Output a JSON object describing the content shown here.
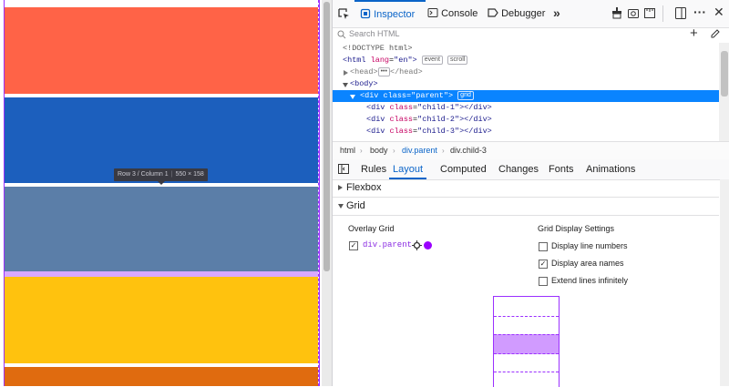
{
  "preview": {
    "tooltip": {
      "area": "Row 3 / Column 1",
      "size": "550 × 158"
    },
    "colors": [
      "#ff6347",
      "#1c5fbd",
      "#5b7ea8",
      "#ffc20e",
      "#e06b0f"
    ]
  },
  "toolbar": {
    "tabs": [
      {
        "label": "Inspector"
      },
      {
        "label": "Console"
      },
      {
        "label": "Debugger"
      }
    ],
    "more_label": "»"
  },
  "search": {
    "placeholder": "Search HTML"
  },
  "markup": {
    "doctype": "<!DOCTYPE html>",
    "html_open": "<html",
    "lang_attr": "lang",
    "lang_val": "\"en\"",
    "html_close_bracket": ">",
    "badge_event": "event",
    "badge_scroll": "scroll",
    "head_open": "<head>",
    "head_close": "</head>",
    "ellipsis": "•••",
    "body_open": "<body>",
    "div_open": "<div",
    "class_attr": "class",
    "parent_val": "\"parent\"",
    "grid_badge": "grid",
    "children": [
      {
        "val": "\"child-1\""
      },
      {
        "val": "\"child-2\""
      },
      {
        "val": "\"child-3\""
      }
    ],
    "div_close": "></div>"
  },
  "breadcrumbs": [
    "html",
    "body",
    "div.parent",
    "div.child-3"
  ],
  "sidebar_tabs": [
    "Rules",
    "Layout",
    "Computed",
    "Changes",
    "Fonts",
    "Animations"
  ],
  "layout": {
    "flexbox_label": "Flexbox",
    "grid_label": "Grid",
    "overlay_grid_label": "Overlay Grid",
    "grid_item": "div.parent",
    "grid_color": "#9b00ff",
    "display_settings_label": "Grid Display Settings",
    "settings": [
      {
        "label": "Display line numbers",
        "checked": false
      },
      {
        "label": "Display area names",
        "checked": true
      },
      {
        "label": "Extend lines infinitely",
        "checked": false
      }
    ]
  }
}
